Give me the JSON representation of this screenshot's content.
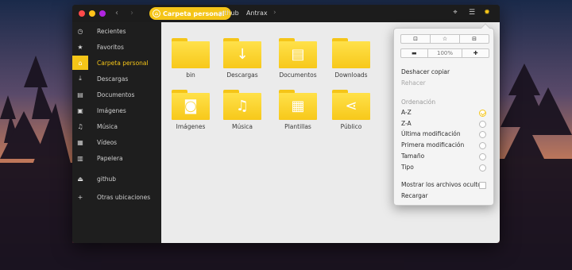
{
  "window": {
    "breadcrumbs": [
      {
        "label": "Carpeta personal",
        "active": true
      },
      {
        "label": "github",
        "active": false
      },
      {
        "label": "Antrax",
        "active": false
      }
    ]
  },
  "sidebar": {
    "items": [
      {
        "label": "Recientes",
        "icon": "clock-icon",
        "glyph": "◷"
      },
      {
        "label": "Favoritos",
        "icon": "star-icon",
        "glyph": "★"
      },
      {
        "label": "Carpeta personal",
        "icon": "home-icon",
        "glyph": "⌂",
        "active": true
      },
      {
        "label": "Descargas",
        "icon": "download-icon",
        "glyph": "⤓"
      },
      {
        "label": "Documentos",
        "icon": "document-icon",
        "glyph": "▤"
      },
      {
        "label": "Imágenes",
        "icon": "image-icon",
        "glyph": "▣"
      },
      {
        "label": "Música",
        "icon": "music-icon",
        "glyph": "♫"
      },
      {
        "label": "Vídeos",
        "icon": "film-icon",
        "glyph": "▦"
      },
      {
        "label": "Papelera",
        "icon": "trash-icon",
        "glyph": "▥"
      },
      {
        "label": "github",
        "icon": "drive-icon",
        "glyph": "⏏"
      },
      {
        "label": "Otras ubicaciones",
        "icon": "plus-icon",
        "glyph": "+"
      }
    ]
  },
  "files": [
    {
      "name": "bin",
      "icon": "folder-icon",
      "glyph": ""
    },
    {
      "name": "Descargas",
      "icon": "folder-download-icon",
      "glyph": "↓"
    },
    {
      "name": "Documentos",
      "icon": "folder-documents-icon",
      "glyph": "▤"
    },
    {
      "name": "Downloads",
      "icon": "folder-icon",
      "glyph": ""
    },
    {
      "name": "Imágenes",
      "icon": "folder-pictures-icon",
      "glyph": "◙"
    },
    {
      "name": "Música",
      "icon": "folder-music-icon",
      "glyph": "♫"
    },
    {
      "name": "Plantillas",
      "icon": "folder-templates-icon",
      "glyph": "▦"
    },
    {
      "name": "Público",
      "icon": "folder-share-icon",
      "glyph": "⋖"
    }
  ],
  "menu": {
    "top_buttons": [
      {
        "icon": "new-folder-icon",
        "glyph": "⊡"
      },
      {
        "icon": "bookmark-star-icon",
        "glyph": "☆"
      },
      {
        "icon": "open-terminal-icon",
        "glyph": "⊟"
      }
    ],
    "zoom": {
      "minus": "▬",
      "value": "100%",
      "plus": "✚"
    },
    "undo": "Deshacer copiar",
    "redo": "Rehacer",
    "sort_header": "Ordenación",
    "sort_options": [
      {
        "label": "A-Z",
        "selected": true
      },
      {
        "label": "Z-A",
        "selected": false
      },
      {
        "label": "Última modificación",
        "selected": false
      },
      {
        "label": "Primera modificación",
        "selected": false
      },
      {
        "label": "Tamaño",
        "selected": false
      },
      {
        "label": "Tipo",
        "selected": false
      }
    ],
    "show_hidden": "Mostrar los archivos ocultos",
    "reload": "Recargar"
  },
  "colors": {
    "accent": "#f5c518",
    "sidebar_bg": "#1e1e1e",
    "content_bg": "#ebebeb",
    "close": "#ff4a4a",
    "minimize": "#ffc21a",
    "maximize": "#b025e0"
  }
}
